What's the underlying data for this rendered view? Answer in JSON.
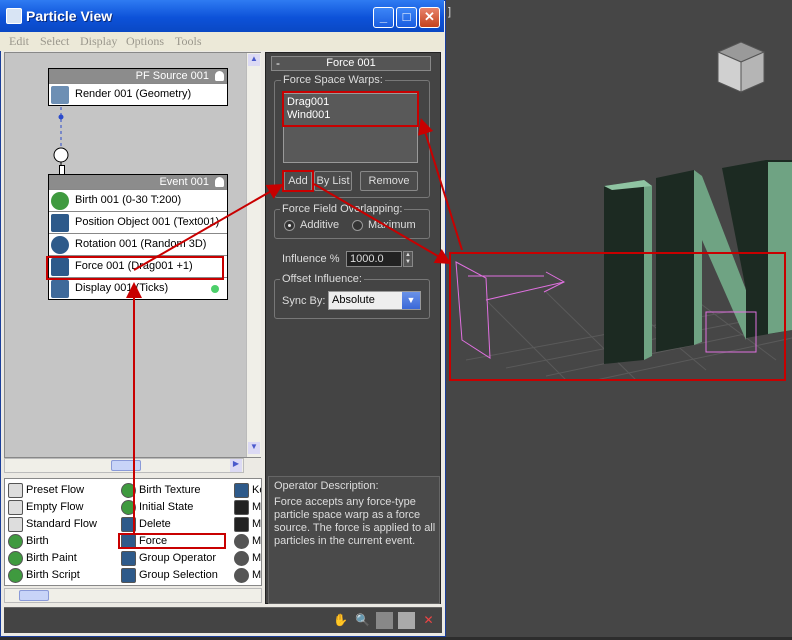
{
  "window": {
    "title": "Particle View"
  },
  "menu": [
    "Edit",
    "Select",
    "Display",
    "Options",
    "Tools"
  ],
  "viewport": {
    "bracket": "]"
  },
  "nodes": {
    "pf_source": {
      "header": "PF Source 001",
      "rows": [
        "Render 001 (Geometry)"
      ]
    },
    "event": {
      "header": "Event 001",
      "rows": [
        "Birth 001 (0-30 T:200)",
        "Position Object 001 (Text001)",
        "Rotation 001 (Random 3D)",
        "Force 001 (Drag001 +1)",
        "Display 001 (Ticks)"
      ]
    }
  },
  "depot": {
    "col1": [
      "Preset Flow",
      "Empty Flow",
      "Standard Flow",
      "Birth",
      "Birth Paint",
      "Birth Script"
    ],
    "col2": [
      "Birth Texture",
      "Initial State",
      "Delete",
      "Force",
      "Group Operator",
      "Group Selection"
    ],
    "col3": [
      "Ke",
      "Ma",
      "Ma",
      "Ma",
      "Ma",
      "Ma"
    ]
  },
  "panel": {
    "rollup_title": "Force 001",
    "rollup_toggle": "-",
    "force_space_warps_label": "Force Space Warps:",
    "warps": [
      "Drag001",
      "Wind001"
    ],
    "add_label": "Add",
    "bylist_label": "By List",
    "remove_label": "Remove",
    "overlap_label": "Force Field Overlapping:",
    "additive_label": "Additive",
    "maximum_label": "Maximum",
    "influence_label": "Influence %",
    "influence_value": "1000.0",
    "offset_label": "Offset Influence:",
    "syncby_label": "Sync By:",
    "syncby_value": "Absolute"
  },
  "description": {
    "title": "Operator Description:",
    "text": "Force accepts any force-type particle space warp as a force source. The force is applied to all particles in the current event."
  },
  "colors": {
    "highlight": "#c80000",
    "title_bar": "#0d52d9",
    "text3d": "#6fa383"
  }
}
